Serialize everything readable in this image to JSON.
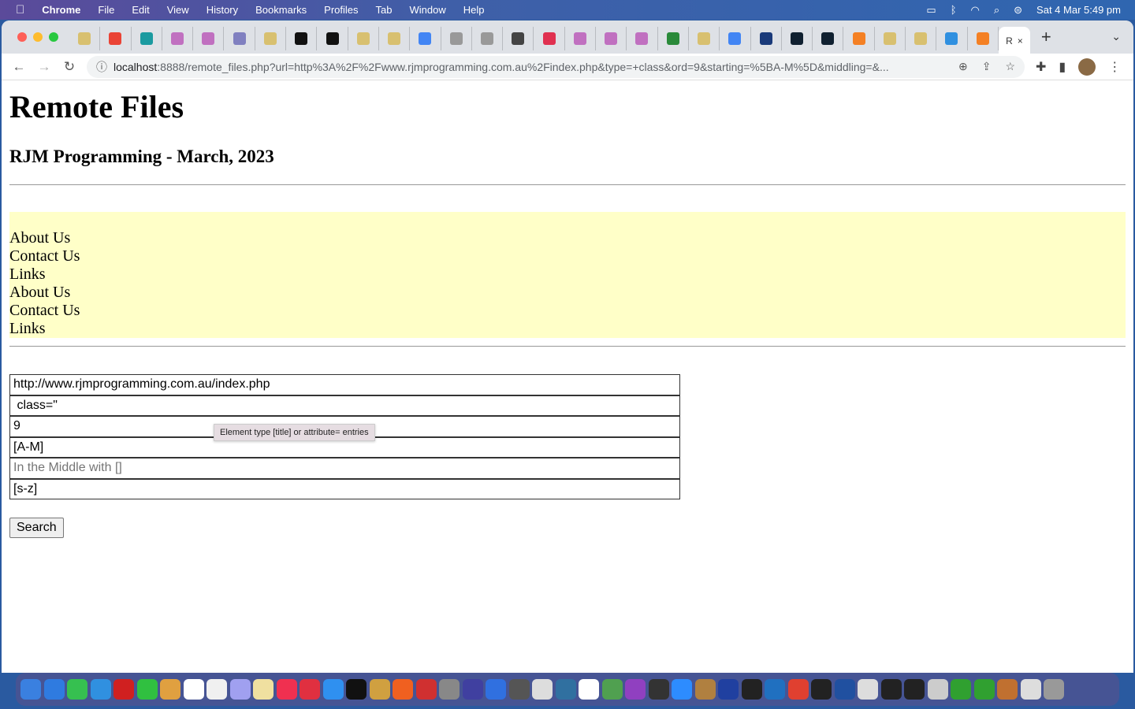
{
  "menubar": {
    "app": "Chrome",
    "items": [
      "File",
      "Edit",
      "View",
      "History",
      "Bookmarks",
      "Profiles",
      "Tab",
      "Window",
      "Help"
    ],
    "clock": "Sat 4 Mar  5:49 pm",
    "status_icons": [
      "battery-icon",
      "bluetooth-icon",
      "wifi-icon",
      "spotlight-icon",
      "control-center-icon"
    ]
  },
  "tabs": [
    {
      "icon": "rjm",
      "color": "#d8c070"
    },
    {
      "icon": "gmail",
      "color": "#ea4335"
    },
    {
      "icon": "c",
      "color": "#1a9aa0"
    },
    {
      "icon": "dots",
      "color": "#c070c0"
    },
    {
      "icon": "dots",
      "color": "#c070c0"
    },
    {
      "icon": "rjm",
      "color": "#8080c0"
    },
    {
      "icon": "rjm",
      "color": "#d8c070"
    },
    {
      "icon": "s",
      "color": "#111"
    },
    {
      "icon": "s",
      "color": "#111"
    },
    {
      "icon": "rjm",
      "color": "#d8c070"
    },
    {
      "icon": "rjm",
      "color": "#d8c070"
    },
    {
      "icon": "google",
      "color": "#4285f4"
    },
    {
      "icon": "rjm",
      "color": "#999"
    },
    {
      "icon": "rjm",
      "color": "#999"
    },
    {
      "icon": "github",
      "color": "#444"
    },
    {
      "icon": "cube",
      "color": "#e03050"
    },
    {
      "icon": "dots",
      "color": "#c070c0"
    },
    {
      "icon": "dots",
      "color": "#c070c0"
    },
    {
      "icon": "dots",
      "color": "#c070c0"
    },
    {
      "icon": "w3",
      "color": "#2a8a3a"
    },
    {
      "icon": "rjm",
      "color": "#d8c070"
    },
    {
      "icon": "google",
      "color": "#4285f4"
    },
    {
      "icon": "w3s",
      "color": "#1a3a7a"
    },
    {
      "icon": "o",
      "color": "#102030"
    },
    {
      "icon": "o",
      "color": "#102030"
    },
    {
      "icon": "stackoverflow",
      "color": "#f48024"
    },
    {
      "icon": "rjm",
      "color": "#d8c070"
    },
    {
      "icon": "rjm",
      "color": "#d8c070"
    },
    {
      "icon": "globe",
      "color": "#3090e0"
    },
    {
      "icon": "stackoverflow",
      "color": "#f48024"
    }
  ],
  "active_tab": {
    "label": "R",
    "close": "×"
  },
  "address": {
    "host": "localhost",
    "rest": ":8888/remote_files.php?url=http%3A%2F%2Fwww.rjmprogramming.com.au%2Findex.php&type=+class&ord=9&starting=%5BA-M%5D&middling=&..."
  },
  "page": {
    "title": "Remote Files",
    "subtitle": "RJM Programming - March, 2023",
    "links": [
      "About Us",
      "Contact Us",
      "Links",
      "About Us",
      "Contact Us",
      "Links"
    ],
    "form": {
      "url": "http://www.rjmprogramming.com.au/index.php",
      "type": " class=\"",
      "ord": "9",
      "starting": "[A-M]",
      "middling": "",
      "middling_placeholder": "In the Middle with []",
      "ending": "[s-z]",
      "search_label": "Search"
    },
    "tooltip": "Element type [title] or attribute= entries"
  },
  "dock": [
    "#3a80e0",
    "#2f7be0",
    "#36c050",
    "#3090e0",
    "#d02020",
    "#30c040",
    "#e0a040",
    "#ffffff",
    "#f0f0f0",
    "#a0a0f0",
    "#f0e0a0",
    "#f03050",
    "#e03040",
    "#2f90f0",
    "#111111",
    "#d0a040",
    "#f06020",
    "#d03030",
    "#888",
    "#4040a0",
    "#3070e0",
    "#555",
    "#ddd",
    "#3070a0",
    "#fff",
    "#50a050",
    "#9040c0",
    "#333",
    "#2d8cff",
    "#b08040",
    "#2040a0",
    "#222",
    "#2070c0",
    "#e04030",
    "#222",
    "#2050a0",
    "#ddd",
    "#222",
    "#222",
    "#ccc",
    "#30a030",
    "#30a030",
    "#c07030",
    "#ddd",
    "#999"
  ]
}
